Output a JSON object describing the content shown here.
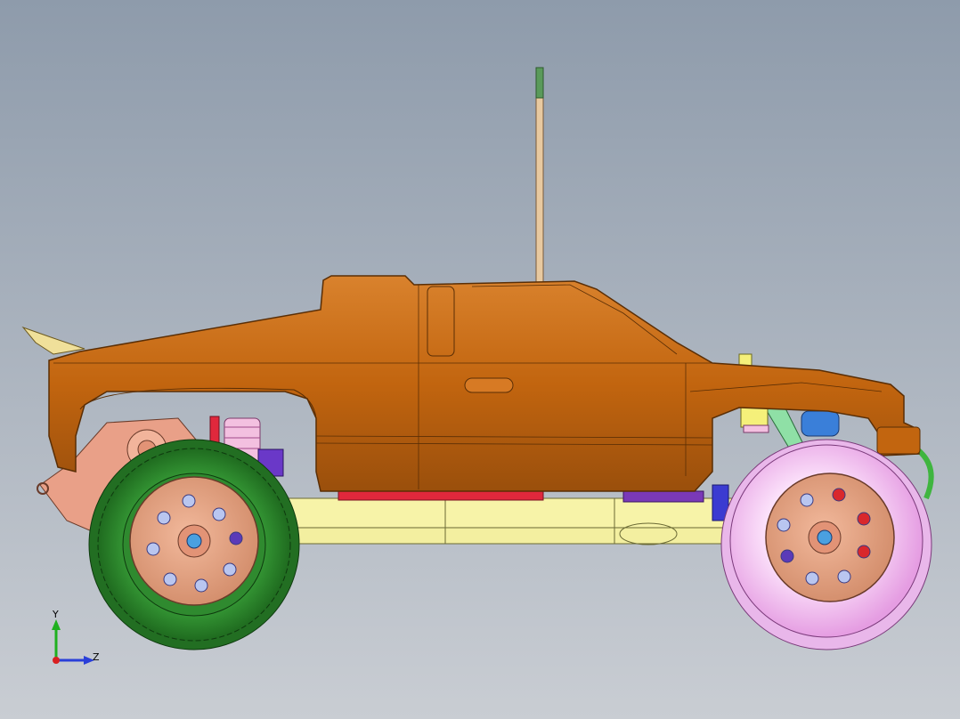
{
  "viewport": {
    "background_top": "#8e9bab",
    "background_bottom": "#c9cdd3"
  },
  "model": {
    "body_color": "#c2650f",
    "chassis_color": "#f7f3a8",
    "rear_tire_color": "#2f8a2f",
    "front_tire_color": "#f2b7f0",
    "rim_color": "#e6a07e",
    "antenna_color": "#e8c9a0",
    "antenna_tip_color": "#5a9a5a"
  },
  "triad": {
    "y_label": "Y",
    "z_label": "Z",
    "y_color": "#1fb01f",
    "z_color": "#2a3fd9",
    "x_color": "#d92020"
  }
}
